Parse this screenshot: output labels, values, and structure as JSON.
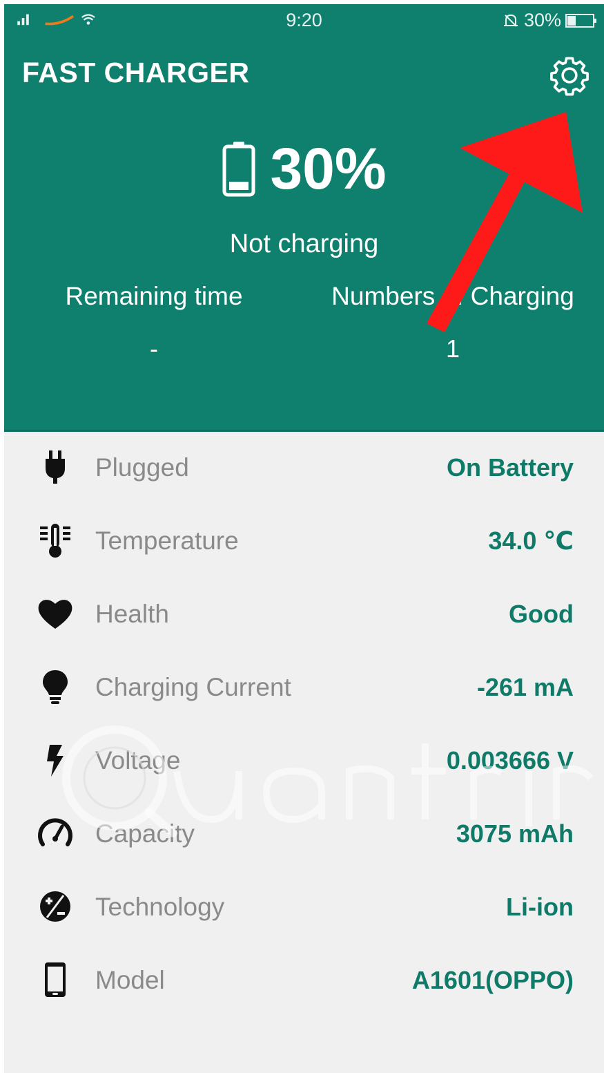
{
  "status_bar": {
    "time": "9:20",
    "battery_pct": "30%"
  },
  "app": {
    "title": "FAST CHARGER"
  },
  "summary": {
    "battery_level": "30%",
    "charge_state": "Not charging",
    "remaining_label": "Remaining time",
    "remaining_value": "-",
    "count_label": "Numbers of Charging",
    "count_value": "1"
  },
  "details": [
    {
      "icon": "plug-icon",
      "label": "Plugged",
      "value": "On Battery"
    },
    {
      "icon": "thermometer-icon",
      "label": "Temperature",
      "value": "34.0 ℃"
    },
    {
      "icon": "heart-icon",
      "label": "Health",
      "value": "Good"
    },
    {
      "icon": "lightbulb-icon",
      "label": "Charging Current",
      "value": "-261 mA"
    },
    {
      "icon": "lightning-icon",
      "label": "Voltage",
      "value": "0.003666 V"
    },
    {
      "icon": "gauge-icon",
      "label": "Capacity",
      "value": "3075 mAh"
    },
    {
      "icon": "technology-icon",
      "label": "Technology",
      "value": "Li-ion"
    },
    {
      "icon": "phone-icon",
      "label": "Model",
      "value": "A1601(OPPO)"
    }
  ],
  "colors": {
    "header_bg": "#10806e",
    "value_text": "#0f7a68",
    "label_text": "#8a8a8a",
    "list_bg": "#f0f0f0",
    "annotation_arrow": "#ff1a1a"
  }
}
